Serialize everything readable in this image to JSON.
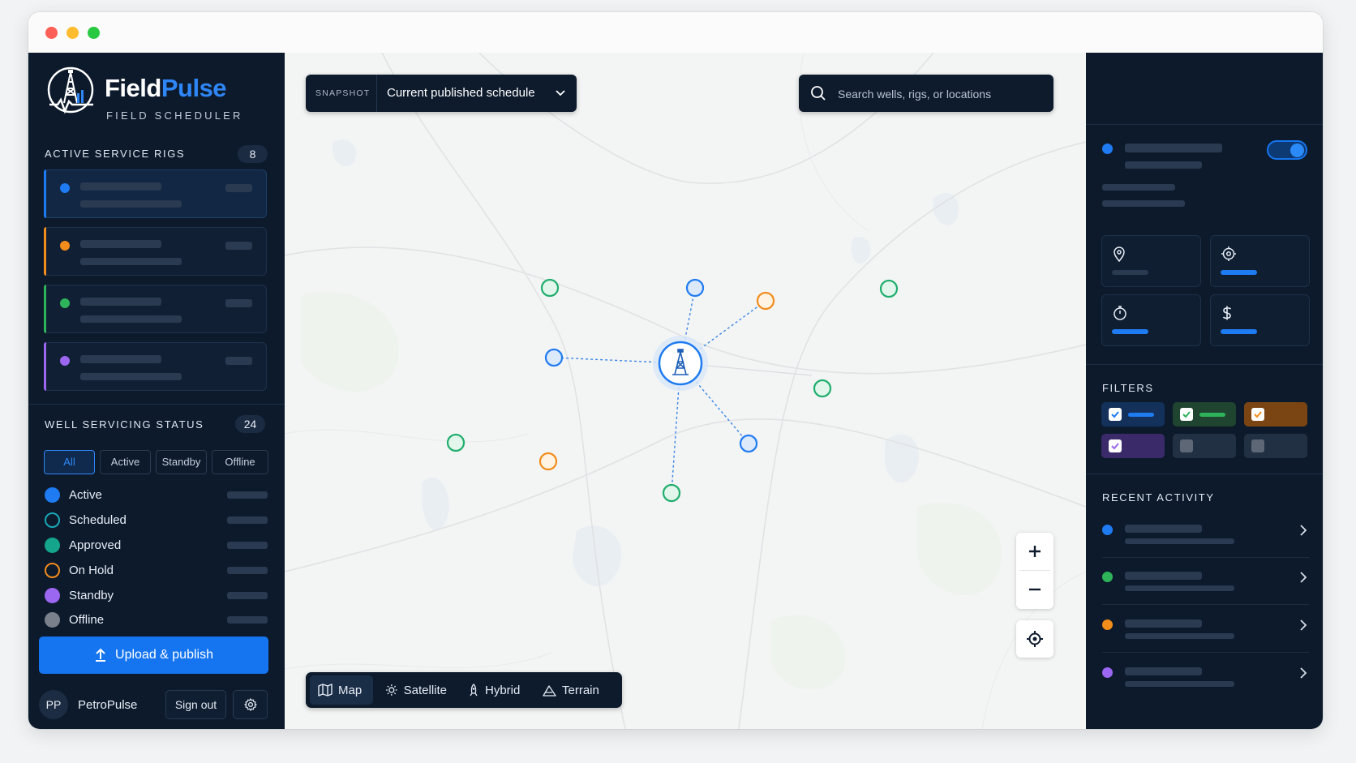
{
  "brand": {
    "name_part1": "Field",
    "name_part2": "Pulse",
    "subtitle": "FIELD SCHEDULER",
    "logo_icon": "oil-derrick-icon",
    "accent": "#2f86f6"
  },
  "rigs": {
    "title": "ACTIVE SERVICE RIGS",
    "count": "8",
    "cards": [
      {
        "color": "#1f7bf2",
        "selected": true
      },
      {
        "color": "#f28c1b"
      },
      {
        "color": "#2fb35a"
      },
      {
        "color": "#9b66f0"
      }
    ]
  },
  "status": {
    "title": "WELL SERVICING STATUS",
    "count": "24",
    "tabs": [
      "All",
      "Active",
      "Standby",
      "Offline"
    ],
    "active_tab": "All",
    "items": [
      {
        "label": "Active",
        "color": "#1f7bf2",
        "style": "filled"
      },
      {
        "label": "Scheduled",
        "color": "#1aa8b8",
        "style": "ring"
      },
      {
        "label": "Approved",
        "color": "#14a58c",
        "style": "filled"
      },
      {
        "label": "On Hold",
        "color": "#f28c1b",
        "style": "ring"
      },
      {
        "label": "Standby",
        "color": "#9b66f0",
        "style": "filled"
      },
      {
        "label": "Offline",
        "color": "#7a818c",
        "style": "filled"
      }
    ]
  },
  "actions": {
    "upload_label": "Upload & publish",
    "upload_icon": "upload-arrow-icon"
  },
  "user": {
    "initials": "PP",
    "name": "PetroPulse",
    "signout_label": "Sign out",
    "settings_icon": "gear-icon"
  },
  "map": {
    "snapshot_tag": "SNAPSHOT",
    "snapshot_value": "Current published schedule",
    "search_placeholder": "Search wells, rigs, or locations",
    "modes": [
      {
        "label": "Map",
        "icon": "map-icon"
      },
      {
        "label": "Satellite",
        "icon": "sun-icon"
      },
      {
        "label": "Hybrid",
        "icon": "rocket-icon"
      },
      {
        "label": "Terrain",
        "icon": "mountain-icon"
      }
    ],
    "active_mode": "Map",
    "controls": {
      "zoom_in": "+",
      "zoom_out": "−",
      "locate_icon": "crosshair-icon"
    }
  },
  "right_panel": {
    "filters_title": "FILTERS",
    "recent_title": "RECENT ACTIVITY",
    "toggle_on": true,
    "tile_icons": [
      "pin-icon",
      "target-icon",
      "stopwatch-icon",
      "dollar-icon"
    ],
    "filter_chip_colors": [
      "#1f7bf2",
      "#2fb35a",
      "#f28c1b",
      "#9b66f0",
      "#6b7380",
      "#6b7380"
    ],
    "activity_colors": [
      "#1f7bf2",
      "#2fb35a",
      "#f28c1b",
      "#9b66f0"
    ]
  },
  "colors": {
    "sidebar_bg": "#0c1a2c",
    "primary": "#1575f0",
    "well_green": "#1fae6c",
    "well_blue": "#2f86f6",
    "well_orange": "#f28c1b"
  }
}
